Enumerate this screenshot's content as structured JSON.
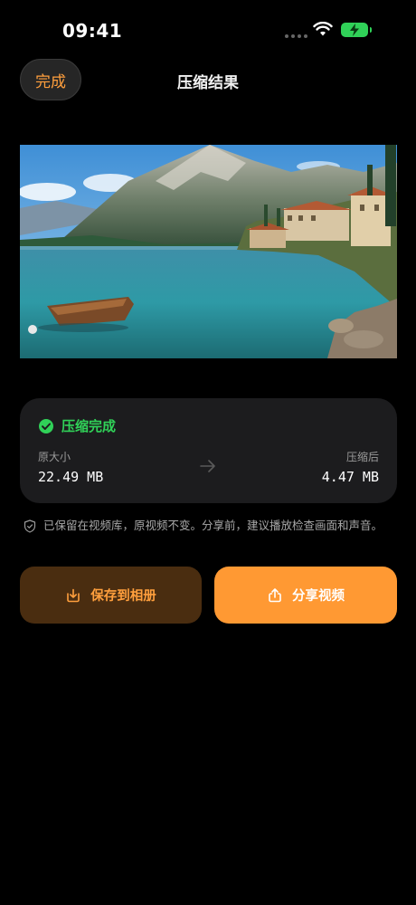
{
  "status_bar": {
    "time": "09:41"
  },
  "header": {
    "done_label": "完成",
    "title": "压缩结果"
  },
  "result": {
    "status": "压缩完成",
    "original_label": "原大小",
    "original_size": "22.49 MB",
    "compressed_label": "压缩后",
    "compressed_size": "4.47 MB"
  },
  "note": "已保留在视频库，原视频不变。分享前，建议播放检查画面和声音。",
  "actions": {
    "save_label": "保存到相册",
    "share_label": "分享视频"
  },
  "colors": {
    "accent": "#ff9f3d",
    "success": "#30d158",
    "save_bg": "#4a2d10",
    "share_bg": "#ff9933"
  }
}
